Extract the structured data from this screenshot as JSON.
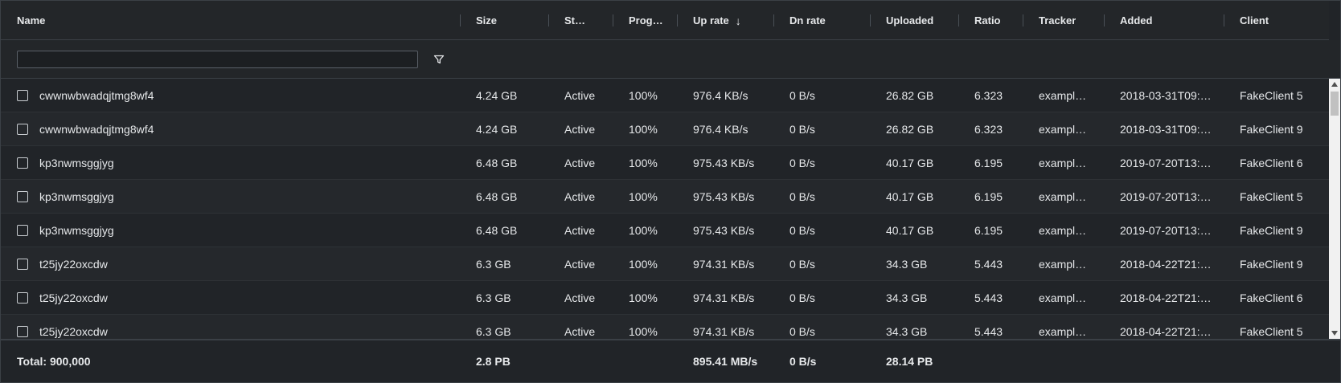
{
  "columns": {
    "name": "Name",
    "size": "Size",
    "status": "St…",
    "progress": "Prog…",
    "up_rate": "Up rate",
    "dn_rate": "Dn rate",
    "uploaded": "Uploaded",
    "ratio": "Ratio",
    "tracker": "Tracker",
    "added": "Added",
    "client": "Client"
  },
  "filter": {
    "value": ""
  },
  "rows": [
    {
      "name": "cwwnwbwadqjtmg8wf4",
      "size": "4.24 GB",
      "status": "Active",
      "progress": "100%",
      "up_rate": "976.4 KB/s",
      "dn_rate": "0 B/s",
      "uploaded": "26.82 GB",
      "ratio": "6.323",
      "tracker": "exampl…",
      "added": "2018-03-31T09:…",
      "client": "FakeClient 5"
    },
    {
      "name": "cwwnwbwadqjtmg8wf4",
      "size": "4.24 GB",
      "status": "Active",
      "progress": "100%",
      "up_rate": "976.4 KB/s",
      "dn_rate": "0 B/s",
      "uploaded": "26.82 GB",
      "ratio": "6.323",
      "tracker": "exampl…",
      "added": "2018-03-31T09:…",
      "client": "FakeClient 9"
    },
    {
      "name": "kp3nwmsggjyg",
      "size": "6.48 GB",
      "status": "Active",
      "progress": "100%",
      "up_rate": "975.43 KB/s",
      "dn_rate": "0 B/s",
      "uploaded": "40.17 GB",
      "ratio": "6.195",
      "tracker": "exampl…",
      "added": "2019-07-20T13:…",
      "client": "FakeClient 6"
    },
    {
      "name": "kp3nwmsggjyg",
      "size": "6.48 GB",
      "status": "Active",
      "progress": "100%",
      "up_rate": "975.43 KB/s",
      "dn_rate": "0 B/s",
      "uploaded": "40.17 GB",
      "ratio": "6.195",
      "tracker": "exampl…",
      "added": "2019-07-20T13:…",
      "client": "FakeClient 5"
    },
    {
      "name": "kp3nwmsggjyg",
      "size": "6.48 GB",
      "status": "Active",
      "progress": "100%",
      "up_rate": "975.43 KB/s",
      "dn_rate": "0 B/s",
      "uploaded": "40.17 GB",
      "ratio": "6.195",
      "tracker": "exampl…",
      "added": "2019-07-20T13:…",
      "client": "FakeClient 9"
    },
    {
      "name": "t25jy22oxcdw",
      "size": "6.3 GB",
      "status": "Active",
      "progress": "100%",
      "up_rate": "974.31 KB/s",
      "dn_rate": "0 B/s",
      "uploaded": "34.3 GB",
      "ratio": "5.443",
      "tracker": "exampl…",
      "added": "2018-04-22T21:…",
      "client": "FakeClient 9"
    },
    {
      "name": "t25jy22oxcdw",
      "size": "6.3 GB",
      "status": "Active",
      "progress": "100%",
      "up_rate": "974.31 KB/s",
      "dn_rate": "0 B/s",
      "uploaded": "34.3 GB",
      "ratio": "5.443",
      "tracker": "exampl…",
      "added": "2018-04-22T21:…",
      "client": "FakeClient 6"
    },
    {
      "name": "t25jy22oxcdw",
      "size": "6.3 GB",
      "status": "Active",
      "progress": "100%",
      "up_rate": "974.31 KB/s",
      "dn_rate": "0 B/s",
      "uploaded": "34.3 GB",
      "ratio": "5.443",
      "tracker": "exampl…",
      "added": "2018-04-22T21:…",
      "client": "FakeClient 5"
    }
  ],
  "footer": {
    "total": "Total: 900,000",
    "size": "2.8 PB",
    "up_rate": "895.41 MB/s",
    "dn_rate": "0 B/s",
    "uploaded": "28.14 PB"
  },
  "icons": {
    "sort": "arrow-down-icon",
    "filter": "funnel-icon",
    "checkbox": "checkbox-unchecked-icon"
  },
  "colors": {
    "background": "#212428",
    "header": "#232629",
    "text": "#e6e8ea",
    "border": "#3b4046"
  }
}
